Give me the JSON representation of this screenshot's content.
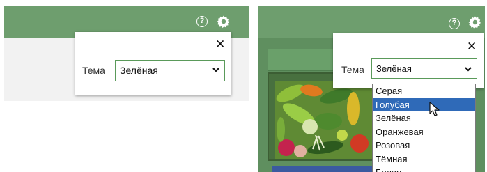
{
  "left_panel": {
    "header": {
      "help_icon": "question-circle-icon",
      "settings_icon": "gear-icon",
      "help_glyph": "?"
    },
    "popup": {
      "close_glyph": "✕",
      "theme_label": "Тема",
      "select": {
        "value": "Зелёная"
      }
    }
  },
  "right_panel": {
    "header": {
      "help_icon": "question-circle-icon",
      "settings_icon": "gear-icon",
      "help_glyph": "?"
    },
    "popup": {
      "close_glyph": "✕",
      "theme_label": "Тема",
      "select": {
        "value": "Зелёная"
      }
    },
    "dropdown": {
      "highlighted_index": 1,
      "options": [
        "Серая",
        "Голубая",
        "Зелёная",
        "Оранжевая",
        "Розовая",
        "Тёмная",
        "Белая"
      ]
    }
  },
  "colors": {
    "header_green": "#6e9e6e",
    "select_border": "#5a9a5a",
    "highlight_blue": "#2f6ab8",
    "background_green": "#5f8f5f"
  }
}
